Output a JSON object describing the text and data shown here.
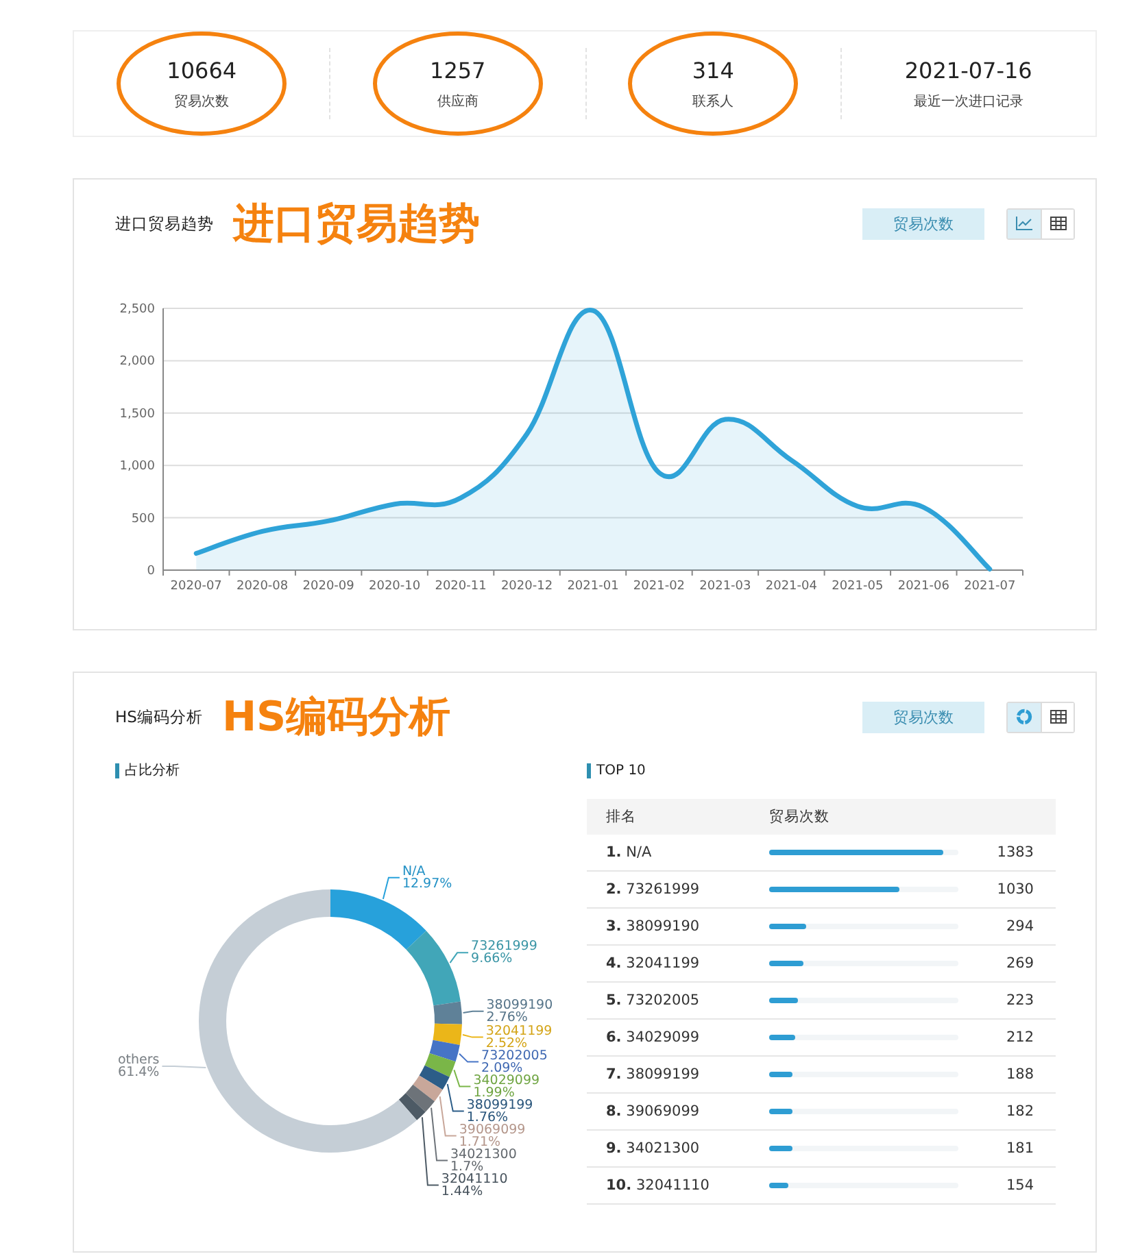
{
  "stats": [
    {
      "value": "10664",
      "label": "贸易次数",
      "circled": true
    },
    {
      "value": "1257",
      "label": "供应商",
      "circled": true
    },
    {
      "value": "314",
      "label": "联系人",
      "circled": true
    },
    {
      "value": "2021-07-16",
      "label": "最近一次进口记录",
      "circled": false
    }
  ],
  "trend_panel": {
    "title": "进口贸易趋势",
    "annotation": "进口贸易趋势",
    "metric_button": "贸易次数",
    "view_toggle": [
      {
        "kind": "line",
        "selected": true
      },
      {
        "kind": "table",
        "selected": false
      }
    ],
    "chart_data": {
      "type": "area",
      "categories": [
        "2020-07",
        "2020-08",
        "2020-09",
        "2020-10",
        "2020-11",
        "2020-12",
        "2021-01",
        "2021-02",
        "2021-03",
        "2021-04",
        "2021-05",
        "2021-06",
        "2021-07"
      ],
      "series": [
        {
          "color": "#2fa3d8",
          "values": [
            160,
            370,
            470,
            630,
            690,
            1300,
            2480,
            930,
            1440,
            1050,
            610,
            600,
            10
          ]
        }
      ],
      "grid": true,
      "ylim": [
        0,
        2500
      ],
      "yticks": [
        {
          "value": 0,
          "label": "0"
        },
        {
          "value": 500,
          "label": "500"
        },
        {
          "value": 1000,
          "label": "1,000"
        },
        {
          "value": 1500,
          "label": "1,500"
        },
        {
          "value": 2000,
          "label": "2,000"
        },
        {
          "value": 2500,
          "label": "2,500"
        }
      ]
    }
  },
  "hs_panel": {
    "title": "HS编码分析",
    "annotation": "HS编码分析",
    "metric_button": "贸易次数",
    "view_toggle": [
      {
        "kind": "donut",
        "selected": true
      },
      {
        "kind": "table",
        "selected": false
      }
    ],
    "share_title": "占比分析",
    "chart_data": {
      "type": "donut",
      "categories": [
        "N/A",
        "73261999",
        "38099190",
        "32041199",
        "73202005",
        "34029099",
        "38099199",
        "39069099",
        "34021300",
        "32041110",
        "others"
      ],
      "series": [
        {
          "values": [
            12.97,
            9.66,
            2.76,
            2.52,
            2.09,
            1.99,
            1.76,
            1.71,
            1.7,
            1.44,
            61.4
          ]
        }
      ],
      "value_labels": [
        "12.97%",
        "9.66%",
        "2.76%",
        "2.52%",
        "2.09%",
        "1.99%",
        "1.76%",
        "1.71%",
        "1.7%",
        "1.44%",
        "61.4%"
      ],
      "colors": [
        "#27a1db",
        "#41a6b8",
        "#5f8198",
        "#ebb619",
        "#4674c6",
        "#7ab648",
        "#2c5d88",
        "#c8a79a",
        "#6d7379",
        "#4d5a65",
        "#c5ced6"
      ]
    },
    "top_title": "TOP 10",
    "columns": [
      "排名",
      "贸易次数"
    ],
    "rows": [
      {
        "rank": "1.",
        "code": "N/A",
        "level": 0.922,
        "count": "1383"
      },
      {
        "rank": "2.",
        "code": "73261999",
        "level": 0.687,
        "count": "1030"
      },
      {
        "rank": "3.",
        "code": "38099190",
        "level": 0.196,
        "count": "294"
      },
      {
        "rank": "4.",
        "code": "32041199",
        "level": 0.179,
        "count": "269"
      },
      {
        "rank": "5.",
        "code": "73202005",
        "level": 0.149,
        "count": "223"
      },
      {
        "rank": "6.",
        "code": "34029099",
        "level": 0.141,
        "count": "212"
      },
      {
        "rank": "7.",
        "code": "38099199",
        "level": 0.125,
        "count": "188"
      },
      {
        "rank": "8.",
        "code": "39069099",
        "level": 0.121,
        "count": "182"
      },
      {
        "rank": "9.",
        "code": "34021300",
        "level": 0.121,
        "count": "181"
      },
      {
        "rank": "10.",
        "code": "32041110",
        "level": 0.103,
        "count": "154"
      }
    ]
  }
}
